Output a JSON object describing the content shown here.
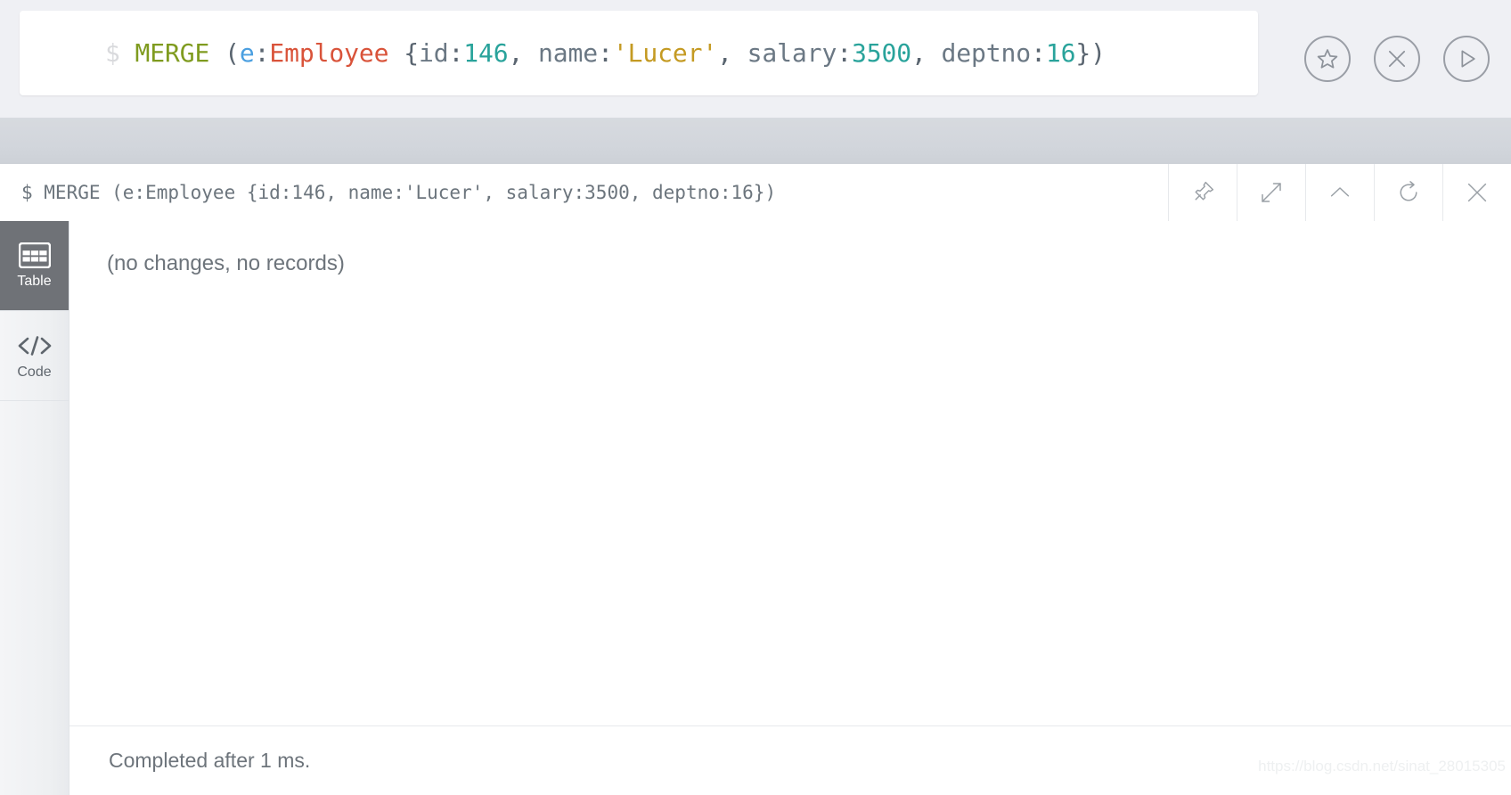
{
  "editor": {
    "prompt": "$",
    "query_plain": "MERGE (e:Employee {id:146, name:'Lucer', salary:3500, deptno:16})",
    "tokens": [
      {
        "text": "MERGE",
        "type": "keyword"
      },
      {
        "text": " (",
        "type": "punct"
      },
      {
        "text": "e",
        "type": "var"
      },
      {
        "text": ":",
        "type": "punct"
      },
      {
        "text": "Employee",
        "type": "label"
      },
      {
        "text": " {",
        "type": "punct"
      },
      {
        "text": "id",
        "type": "key"
      },
      {
        "text": ":",
        "type": "punct"
      },
      {
        "text": "146",
        "type": "number"
      },
      {
        "text": ", ",
        "type": "punct"
      },
      {
        "text": "name",
        "type": "key"
      },
      {
        "text": ":",
        "type": "punct"
      },
      {
        "text": "'Lucer'",
        "type": "string"
      },
      {
        "text": ", ",
        "type": "punct"
      },
      {
        "text": "salary",
        "type": "key"
      },
      {
        "text": ":",
        "type": "punct"
      },
      {
        "text": "3500",
        "type": "number"
      },
      {
        "text": ", ",
        "type": "punct"
      },
      {
        "text": "deptno",
        "type": "key"
      },
      {
        "text": ":",
        "type": "punct"
      },
      {
        "text": "16",
        "type": "number"
      },
      {
        "text": "})",
        "type": "punct"
      }
    ],
    "actions": [
      {
        "name": "favorite-button",
        "icon": "star-circle-icon",
        "title": "Favorite"
      },
      {
        "name": "clear-button",
        "icon": "close-circle-icon",
        "title": "Clear"
      },
      {
        "name": "run-button",
        "icon": "play-circle-icon",
        "title": "Run"
      }
    ]
  },
  "frame": {
    "title": "$ MERGE (e:Employee {id:146, name:'Lucer', salary:3500, deptno:16})",
    "buttons": [
      {
        "name": "pin-frame-button",
        "icon": "pin-icon",
        "title": "Pin"
      },
      {
        "name": "expand-frame-button",
        "icon": "expand-icon",
        "title": "Expand"
      },
      {
        "name": "collapse-frame-button",
        "icon": "chevron-up-icon",
        "title": "Collapse"
      },
      {
        "name": "refresh-frame-button",
        "icon": "refresh-icon",
        "title": "Rerun"
      },
      {
        "name": "close-frame-button",
        "icon": "close-icon",
        "title": "Close"
      }
    ]
  },
  "views": {
    "tabs": [
      {
        "name": "view-tab-table",
        "label": "Table",
        "icon": "table-icon",
        "active": true
      },
      {
        "name": "view-tab-code",
        "label": "Code",
        "icon": "code-icon",
        "active": false
      }
    ]
  },
  "result": {
    "message": "(no changes, no records)"
  },
  "status": {
    "text": "Completed after 1 ms."
  },
  "watermark": {
    "text": "https://blog.csdn.net/sinat_28015305"
  },
  "colors": {
    "editor_bg": "#eff0f4",
    "gray_band": "#d2d6dc",
    "active_tab_bg": "#6f7277",
    "sidebar_bg": "#eef0f2",
    "keyword": "#7f9b1f",
    "variable": "#4a9fe0",
    "label": "#d9533a",
    "number": "#29a39b",
    "string": "#c49a22",
    "punct": "#5a6570",
    "text_gray": "#6d747b"
  }
}
